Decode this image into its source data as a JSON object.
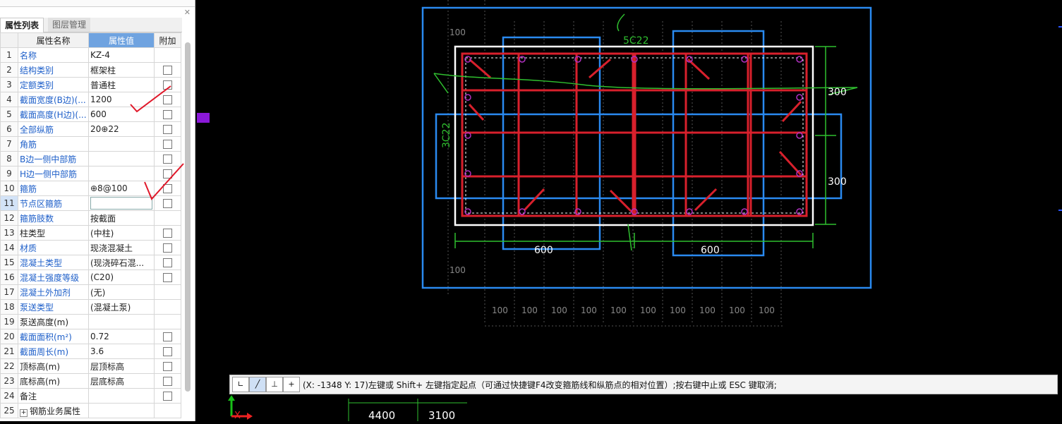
{
  "panel": {
    "tabs": [
      "属性列表",
      "图层管理"
    ],
    "headers": {
      "name": "属性名称",
      "value": "属性值",
      "add": "附加"
    },
    "rows": [
      {
        "num": "1",
        "name": "名称",
        "value": "KZ-4",
        "name_color": "blue",
        "checkbox": false
      },
      {
        "num": "2",
        "name": "结构类别",
        "value": "框架柱",
        "name_color": "blue",
        "checkbox": true
      },
      {
        "num": "3",
        "name": "定额类别",
        "value": "普通柱",
        "name_color": "blue",
        "checkbox": true
      },
      {
        "num": "4",
        "name": "截面宽度(B边)(...",
        "value": "1200",
        "name_color": "blue",
        "checkbox": true
      },
      {
        "num": "5",
        "name": "截面高度(H边)(...",
        "value": "600",
        "name_color": "blue",
        "checkbox": true
      },
      {
        "num": "6",
        "name": "全部纵筋",
        "value": "20⊕22",
        "name_color": "blue",
        "checkbox": true
      },
      {
        "num": "7",
        "name": "角筋",
        "value": "",
        "name_color": "blue",
        "checkbox": true
      },
      {
        "num": "8",
        "name": "B边一侧中部筋",
        "value": "",
        "name_color": "blue",
        "checkbox": true
      },
      {
        "num": "9",
        "name": "H边一侧中部筋",
        "value": "",
        "name_color": "blue",
        "checkbox": true
      },
      {
        "num": "10",
        "name": "箍筋",
        "value": "⊕8@100",
        "name_color": "blue",
        "checkbox": true
      },
      {
        "num": "11",
        "name": "节点区箍筋",
        "value": "",
        "name_color": "blue",
        "checkbox": true
      },
      {
        "num": "12",
        "name": "箍筋肢数",
        "value": "按截面",
        "name_color": "blue",
        "checkbox": false
      },
      {
        "num": "13",
        "name": "柱类型",
        "value": "(中柱)",
        "name_color": "black",
        "checkbox": true
      },
      {
        "num": "14",
        "name": "材质",
        "value": "现浇混凝土",
        "name_color": "blue",
        "checkbox": true
      },
      {
        "num": "15",
        "name": "混凝土类型",
        "value": "(现浇碎石混...",
        "name_color": "blue",
        "checkbox": true
      },
      {
        "num": "16",
        "name": "混凝土强度等级",
        "value": "(C20)",
        "name_color": "blue",
        "checkbox": true
      },
      {
        "num": "17",
        "name": "混凝土外加剂",
        "value": "(无)",
        "name_color": "blue",
        "checkbox": false
      },
      {
        "num": "18",
        "name": "泵送类型",
        "value": "(混凝土泵)",
        "name_color": "blue",
        "checkbox": false
      },
      {
        "num": "19",
        "name": "泵送高度(m)",
        "value": "",
        "name_color": "black",
        "checkbox": false
      },
      {
        "num": "20",
        "name": "截面面积(m²)",
        "value": "0.72",
        "name_color": "blue",
        "checkbox": true,
        "value_grey": true
      },
      {
        "num": "21",
        "name": "截面周长(m)",
        "value": "3.6",
        "name_color": "blue",
        "checkbox": true,
        "value_grey": true
      },
      {
        "num": "22",
        "name": "顶标高(m)",
        "value": "层顶标高",
        "name_color": "black",
        "checkbox": true
      },
      {
        "num": "23",
        "name": "底标高(m)",
        "value": "层底标高",
        "name_color": "black",
        "checkbox": true
      },
      {
        "num": "24",
        "name": "备注",
        "value": "",
        "name_color": "black",
        "checkbox": true
      },
      {
        "num": "25",
        "name": "钢筋业务属性",
        "value": "",
        "name_color": "black",
        "checkbox": false,
        "expander": "+"
      }
    ]
  },
  "drawing": {
    "labels": {
      "top_rebar": "5C22",
      "side_rebar": "3C22",
      "dim_300_a": "300",
      "dim_300_b": "300",
      "dim_600_a": "600",
      "dim_600_b": "600",
      "grid_100": "100",
      "bottom_4400": "4400",
      "bottom_3100": "3100"
    }
  },
  "status": {
    "text": "(X: -1348 Y: 17)左键或 Shift+ 左键指定起点（可通过快捷键F4改变箍筋线和纵筋点的相对位置）;按右键中止或 ESC 键取消;",
    "buttons": [
      "line-mode-1",
      "line-mode-2",
      "line-mode-3",
      "add-mode"
    ]
  },
  "colors": {
    "rebar": "#d8202c",
    "highlight": "#2a8af0",
    "dim": "#2fbf2f",
    "section": "#ffffff"
  },
  "axis": {
    "x_label": "X"
  }
}
